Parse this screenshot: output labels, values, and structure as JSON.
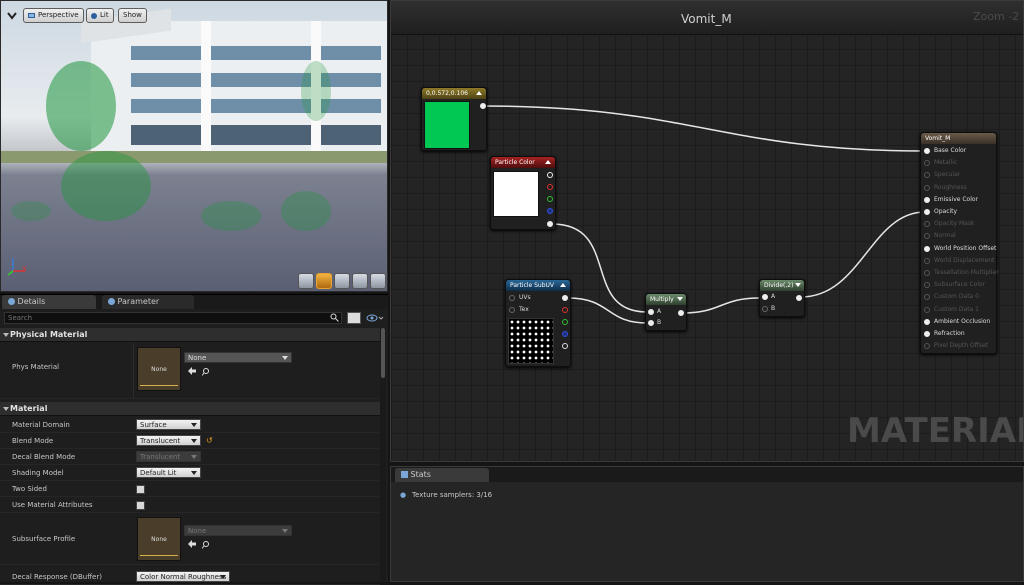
{
  "viewport": {
    "buttons": [
      "Perspective",
      "Lit",
      "Show"
    ],
    "axis_x": "X"
  },
  "details": {
    "tabs": [
      "Details",
      "Parameter Defaults"
    ],
    "search_placeholder": "Search",
    "physical_section": "Physical Material",
    "phys_material_label": "Phys Material",
    "phys_material_thumb": "None",
    "phys_material_value": "None",
    "material_section": "Material",
    "rows": [
      {
        "label": "Material Domain",
        "value": "Surface",
        "kind": "dropdown"
      },
      {
        "label": "Blend Mode",
        "value": "Translucent",
        "kind": "dropdown"
      },
      {
        "label": "Decal Blend Mode",
        "value": "Translucent",
        "kind": "dropdown-disabled"
      },
      {
        "label": "Shading Model",
        "value": "Default Lit",
        "kind": "dropdown"
      },
      {
        "label": "Two Sided",
        "value": "",
        "kind": "checkbox"
      },
      {
        "label": "Use Material Attributes",
        "value": "",
        "kind": "checkbox"
      }
    ],
    "subsurface_label": "Subsurface Profile",
    "subsurface_thumb": "None",
    "subsurface_value": "None",
    "decal_label": "Decal Response (DBuffer)",
    "decal_value": "Color Normal Roughness"
  },
  "graph": {
    "title": "Vomit_M",
    "zoom": "Zoom -2",
    "watermark": "MATERIAL",
    "const_node": {
      "title": "0,0.572,0.106",
      "color": "#00c853"
    },
    "particle_color": {
      "title": "Particle Color"
    },
    "subuv": {
      "title": "Particle SubUV",
      "inputs": [
        "UVs",
        "Tex"
      ]
    },
    "multiply": {
      "title": "Multiply",
      "inputs": [
        "A",
        "B"
      ]
    },
    "divide": {
      "title": "Divide(,2)",
      "inputs": [
        "A",
        "B"
      ]
    },
    "result": {
      "title": "Vomit_M",
      "pins": [
        {
          "label": "Base Color",
          "active": true
        },
        {
          "label": "Metallic",
          "active": false
        },
        {
          "label": "Specular",
          "active": false
        },
        {
          "label": "Roughness",
          "active": false
        },
        {
          "label": "Emissive Color",
          "active": true
        },
        {
          "label": "Opacity",
          "active": true
        },
        {
          "label": "Opacity Mask",
          "active": false
        },
        {
          "label": "Normal",
          "active": false
        },
        {
          "label": "World Position Offset",
          "active": true
        },
        {
          "label": "World Displacement",
          "active": false
        },
        {
          "label": "Tessellation Multiplier",
          "active": false
        },
        {
          "label": "Subsurface Color",
          "active": false
        },
        {
          "label": "Custom Data 0",
          "active": false
        },
        {
          "label": "Custom Data 1",
          "active": false
        },
        {
          "label": "Ambient Occlusion",
          "active": true
        },
        {
          "label": "Refraction",
          "active": true
        },
        {
          "label": "Pixel Depth Offset",
          "active": false
        }
      ]
    }
  },
  "stats": {
    "tab": "Stats",
    "line": "Texture samplers: 3/16"
  }
}
